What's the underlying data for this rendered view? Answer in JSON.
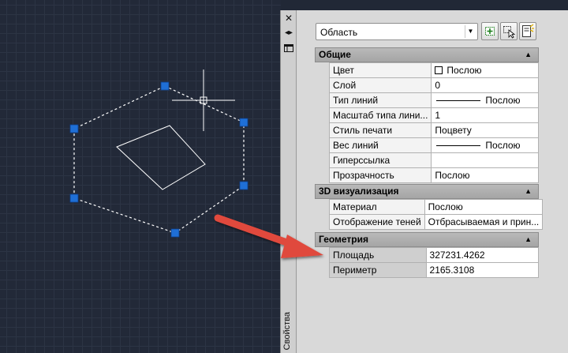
{
  "palette": {
    "side_title": "Свойства",
    "side_icons": [
      "close-icon",
      "auto-hide-icon",
      "properties-menu-icon"
    ],
    "selector_value": "Область",
    "tool_icons": [
      "toggle-pickadd-icon",
      "select-objects-icon",
      "quick-select-icon"
    ]
  },
  "sections": {
    "general": {
      "title": "Общие",
      "rows": [
        {
          "name": "Цвет",
          "value": "Послою"
        },
        {
          "name": "Слой",
          "value": "0"
        },
        {
          "name": "Тип линий",
          "value": "Послою"
        },
        {
          "name": "Масштаб типа лини...",
          "value": "1"
        },
        {
          "name": "Стиль печати",
          "value": "Поцвету"
        },
        {
          "name": "Вес линий",
          "value": "Послою"
        },
        {
          "name": "Гиперссылка",
          "value": ""
        },
        {
          "name": "Прозрачность",
          "value": "Послою"
        }
      ]
    },
    "viz3d": {
      "title": "3D визуализация",
      "rows": [
        {
          "name": "Материал",
          "value": "Послою"
        },
        {
          "name": "Отображение теней",
          "value": "Отбрасываемая и прин..."
        }
      ]
    },
    "geometry": {
      "title": "Геометрия",
      "rows": [
        {
          "name": "Площадь",
          "value": "327231.4262"
        },
        {
          "name": "Периметр",
          "value": "2165.3108"
        }
      ]
    }
  },
  "colors": {
    "canvas_bg": "#222938",
    "grip": "#1f6fd6",
    "arrow": "#e04a3c"
  }
}
